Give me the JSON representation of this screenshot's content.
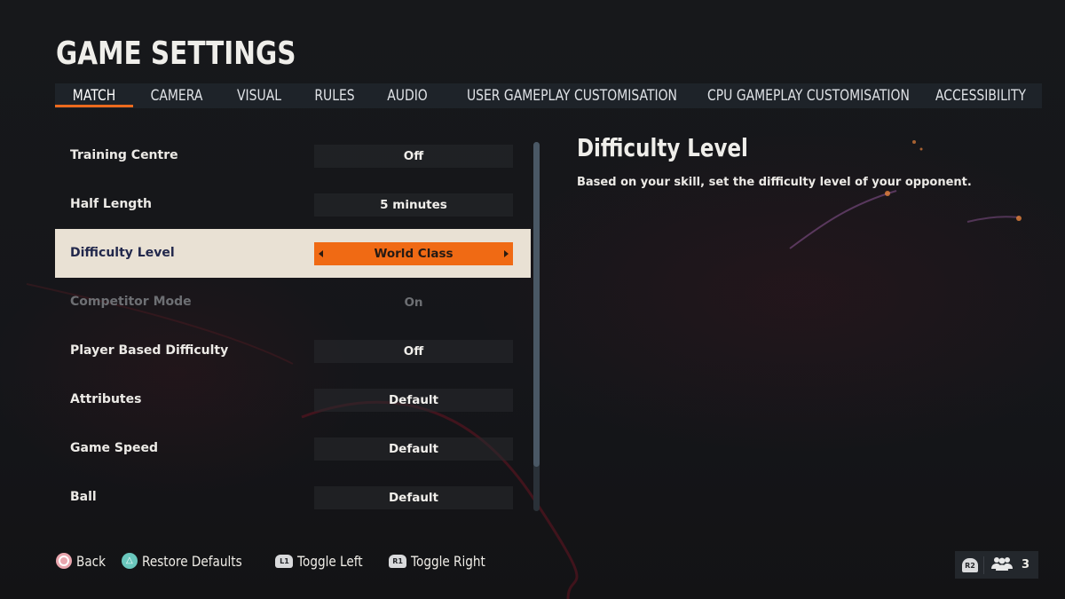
{
  "header": {
    "title": "GAME SETTINGS"
  },
  "tabs": [
    {
      "label": "MATCH",
      "active": true
    },
    {
      "label": "CAMERA",
      "active": false
    },
    {
      "label": "VISUAL",
      "active": false
    },
    {
      "label": "RULES",
      "active": false
    },
    {
      "label": "AUDIO",
      "active": false
    },
    {
      "label": "USER GAMEPLAY CUSTOMISATION",
      "active": false
    },
    {
      "label": "CPU GAMEPLAY CUSTOMISATION",
      "active": false
    },
    {
      "label": "ACCESSIBILITY",
      "active": false
    }
  ],
  "settings": [
    {
      "label": "Training Centre",
      "value": "Off",
      "state": "normal"
    },
    {
      "label": "Half Length",
      "value": "5 minutes",
      "state": "normal"
    },
    {
      "label": "Difficulty Level",
      "value": "World Class",
      "state": "selected"
    },
    {
      "label": "Competitor Mode",
      "value": "On",
      "state": "disabled"
    },
    {
      "label": "Player Based Difficulty",
      "value": "Off",
      "state": "normal"
    },
    {
      "label": "Attributes",
      "value": "Default",
      "state": "normal"
    },
    {
      "label": "Game Speed",
      "value": "Default",
      "state": "normal"
    },
    {
      "label": "Ball",
      "value": "Default",
      "state": "normal"
    }
  ],
  "scroll": {
    "visible_fraction": 0.88,
    "position_fraction": 0.0
  },
  "detail": {
    "title": "Difficulty Level",
    "description": "Based on your skill, set the difficulty level of your opponent."
  },
  "footer": {
    "hints": [
      {
        "button": "circle",
        "label": "Back"
      },
      {
        "button": "triangle",
        "label": "Restore Defaults"
      },
      {
        "button": "L1",
        "label": "Toggle Left"
      },
      {
        "button": "R1",
        "label": "Toggle Right"
      }
    ],
    "players": {
      "button": "R2",
      "icon": "players-group-icon",
      "count": "3"
    }
  },
  "colors": {
    "accent": "#f06a14",
    "selected_row_bg": "#e9e1d4",
    "selected_row_label": "#22284c",
    "tab_underline": "#ec6a1e"
  }
}
